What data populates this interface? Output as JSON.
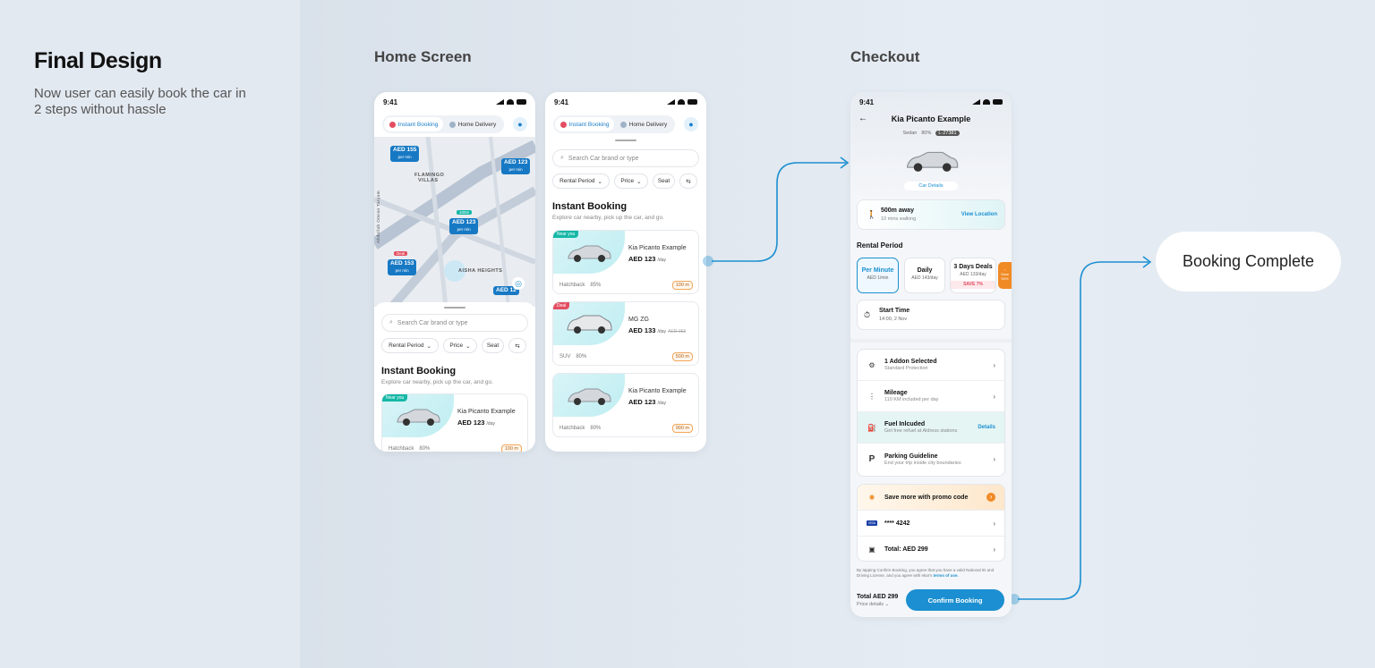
{
  "intro": {
    "title": "Final Design",
    "subtitle": "Now user can easily book the car in 2 steps without hassle"
  },
  "sections": {
    "home": "Home Screen",
    "checkout": "Checkout"
  },
  "status_time": "9:41",
  "tabs": {
    "instant": "Instant Booking",
    "delivery": "Home Delivery"
  },
  "search_placeholder": "Search Car brand or type",
  "filters": {
    "rental": "Rental Period",
    "price": "Price",
    "seat": "Seat"
  },
  "listing": {
    "title": "Instant Booking",
    "subtitle": "Explore car nearby, pick up the car, and go."
  },
  "map": {
    "labels": {
      "flamingo": "FLAMINGO",
      "villas": "VILLAS",
      "aisha": "AISHA HEIGHTS",
      "road": "Abdullah Omran Taryam"
    },
    "pins": [
      {
        "price": "AED 155",
        "unit": "per min"
      },
      {
        "price": "AED 123",
        "unit": "per min"
      },
      {
        "price": "AED 123",
        "unit": "per min",
        "badge": "100m"
      },
      {
        "price": "AED 153",
        "unit": "per min",
        "badge": "Deal"
      },
      {
        "price": "AED 12"
      }
    ]
  },
  "cars": [
    {
      "tag": "Near you",
      "name": "Kia Picanto Example",
      "price": "AED 123",
      "unit": "/day",
      "type": "Hatchback",
      "fuel": "85%",
      "distance": "100 m"
    },
    {
      "tag": "Deal",
      "name": "MG ZG",
      "price": "AED 133",
      "unit": "/day",
      "old": "AED 153",
      "type": "SUV",
      "fuel": "80%",
      "distance": "500 m"
    },
    {
      "tag": "",
      "name": "Kia Picanto Example",
      "price": "AED 123",
      "unit": "/day",
      "type": "Hatchback",
      "fuel": "80%",
      "distance": "900 m"
    }
  ],
  "home_card": {
    "tag": "Near you",
    "name": "Kia Picanto Example",
    "price": "AED 123",
    "unit": "/day",
    "type": "Hatchback",
    "fuel": "80%",
    "distance": "100 m"
  },
  "checkout": {
    "title": "Kia Picanto Example",
    "type": "Sedan",
    "fuel": "80%",
    "plate": "L-27381",
    "details_link": "Car Details",
    "away": "500m away",
    "walking": "10 mins walking",
    "view_location": "View Location",
    "rental_period": "Rental Period",
    "periods": [
      {
        "name": "Per Minute",
        "price": "AED 1",
        "unit": "/min"
      },
      {
        "name": "Daily",
        "price": "AED 143",
        "unit": "/day"
      },
      {
        "name": "3 Days Deals",
        "price": "AED 133",
        "unit": "/day",
        "save": "SAVE 7%"
      }
    ],
    "peek": "Save 50%",
    "start_label": "Start Time",
    "start_value": "14:00, 2 Nov",
    "rows": [
      {
        "t1": "1 Addon Selected",
        "t2": "Standard Protection",
        "icon": "⚙"
      },
      {
        "t1": "Mileage",
        "t2": "110 KM included per day",
        "icon": "⋮"
      },
      {
        "t1": "Fuel Inlcuded",
        "t2": "Get free refuel at Aldress stations",
        "icon": "⛽",
        "action": "Details"
      },
      {
        "t1": "Parking Guideline",
        "t2": "End your trip inside city boundaries",
        "icon": "P"
      }
    ],
    "promo": "Save more with promo code",
    "card": "**** 4242",
    "card_brand": "VISA",
    "total_row": "Total: AED 299",
    "terms": "By tapping Confirm Booking, you agree that you have a valid National ID and Driving License, and you agree with ekar's",
    "terms_link": "terms of use.",
    "total": "Total AED 299",
    "price_details": "Price details",
    "confirm": "Confirm Booking"
  },
  "complete": "Booking Complete",
  "colors": {
    "primary": "#1b8fd1",
    "teal": "#14b8a6",
    "deal": "#e44e61",
    "orange": "#f08a24"
  }
}
